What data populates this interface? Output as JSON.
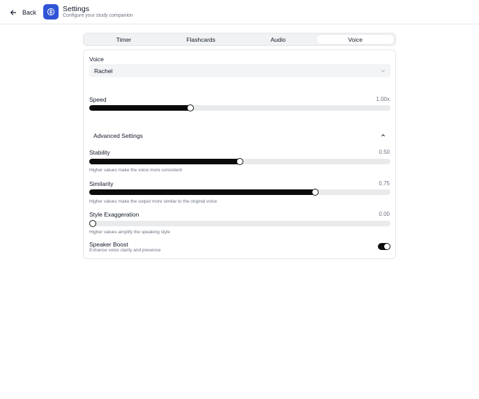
{
  "header": {
    "back_label": "Back",
    "title": "Settings",
    "subtitle": "Configure your study companion",
    "app_icon": "brain-icon",
    "accent_color": "#2f54d6"
  },
  "tabs": [
    {
      "label": "Timer",
      "active": false
    },
    {
      "label": "Flashcards",
      "active": false
    },
    {
      "label": "Audio",
      "active": false
    },
    {
      "label": "Voice",
      "active": true
    }
  ],
  "voice": {
    "label": "Voice",
    "selected": "Rachel"
  },
  "speed": {
    "label": "Speed",
    "value_text": "1.00x",
    "fraction": 0.335
  },
  "advanced": {
    "label": "Advanced Settings",
    "expanded": true,
    "stability": {
      "label": "Stability",
      "value_text": "0.50",
      "fraction": 0.5,
      "hint": "Higher values make the voice more consistent"
    },
    "similarity": {
      "label": "Similarity",
      "value_text": "0.75",
      "fraction": 0.75,
      "hint": "Higher values make the output more similar to the original voice"
    },
    "style": {
      "label": "Style Exaggeration",
      "value_text": "0.00",
      "fraction": 0.0,
      "hint": "Higher values amplify the speaking style"
    },
    "speaker_boost": {
      "label": "Speaker Boost",
      "description": "Enhance voice clarity and presence",
      "enabled": true
    }
  }
}
